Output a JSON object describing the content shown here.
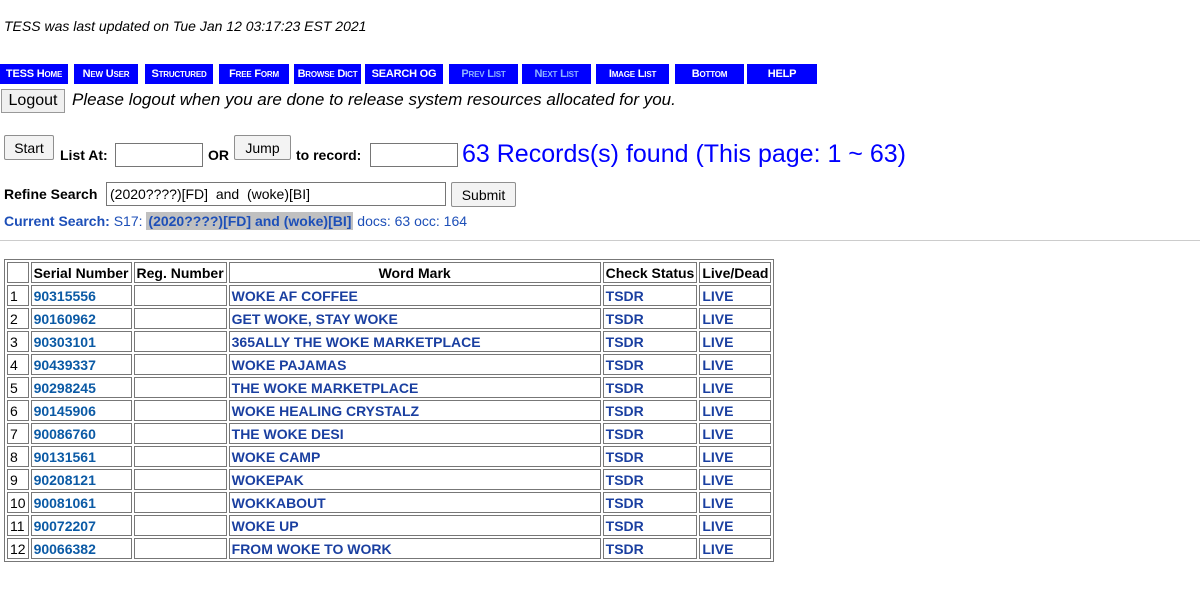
{
  "header": {
    "updated": "TESS was last updated on Tue Jan 12 03:17:23 EST 2021"
  },
  "nav": [
    {
      "label": "TESS Home",
      "dim": false
    },
    {
      "label": "New User",
      "dim": false
    },
    {
      "label": "Structured",
      "dim": false
    },
    {
      "label": "Free Form",
      "dim": false
    },
    {
      "label": "Browse Dict",
      "dim": false
    },
    {
      "label": "SEARCH OG",
      "dim": false
    },
    {
      "label": "Prev List",
      "dim": true
    },
    {
      "label": "Next List",
      "dim": true
    },
    {
      "label": "Image List",
      "dim": false
    },
    {
      "label": "Bottom",
      "dim": false
    },
    {
      "label": "HELP",
      "dim": false
    }
  ],
  "logout": {
    "button": "Logout",
    "message": "Please logout when you are done to release system resources allocated for you."
  },
  "listnav": {
    "start": "Start",
    "list_at": "List At:",
    "or": "OR",
    "jump": "Jump",
    "to_record": "to record:",
    "list_at_value": "",
    "record_value": ""
  },
  "records_found": "63 Records(s) found (This page: 1 ~ 63)",
  "refine": {
    "label": "Refine Search",
    "value": "(2020????)[FD]  and  (woke)[BI]",
    "submit": "Submit"
  },
  "current": {
    "label": "Current Search:",
    "id": "S17:",
    "query": "(2020????)[FD] and (woke)[BI]",
    "stats": "docs: 63 occ: 164"
  },
  "table": {
    "headers": [
      "",
      "Serial Number",
      "Reg. Number",
      "Word Mark",
      "Check Status",
      "Live/Dead"
    ],
    "rows": [
      {
        "n": "1",
        "serial": "90315556",
        "reg": "",
        "mark": "WOKE AF COFFEE",
        "check": "TSDR",
        "status": "LIVE"
      },
      {
        "n": "2",
        "serial": "90160962",
        "reg": "",
        "mark": "GET WOKE, STAY WOKE",
        "check": "TSDR",
        "status": "LIVE"
      },
      {
        "n": "3",
        "serial": "90303101",
        "reg": "",
        "mark": "365ALLY THE WOKE MARKETPLACE",
        "check": "TSDR",
        "status": "LIVE"
      },
      {
        "n": "4",
        "serial": "90439337",
        "reg": "",
        "mark": "WOKE PAJAMAS",
        "check": "TSDR",
        "status": "LIVE"
      },
      {
        "n": "5",
        "serial": "90298245",
        "reg": "",
        "mark": "THE WOKE MARKETPLACE",
        "check": "TSDR",
        "status": "LIVE"
      },
      {
        "n": "6",
        "serial": "90145906",
        "reg": "",
        "mark": "WOKE HEALING CRYSTALZ",
        "check": "TSDR",
        "status": "LIVE"
      },
      {
        "n": "7",
        "serial": "90086760",
        "reg": "",
        "mark": "THE WOKE DESI",
        "check": "TSDR",
        "status": "LIVE"
      },
      {
        "n": "8",
        "serial": "90131561",
        "reg": "",
        "mark": "WOKE CAMP",
        "check": "TSDR",
        "status": "LIVE"
      },
      {
        "n": "9",
        "serial": "90208121",
        "reg": "",
        "mark": "WOKEPAK",
        "check": "TSDR",
        "status": "LIVE"
      },
      {
        "n": "10",
        "serial": "90081061",
        "reg": "",
        "mark": "WOKKABOUT",
        "check": "TSDR",
        "status": "LIVE"
      },
      {
        "n": "11",
        "serial": "90072207",
        "reg": "",
        "mark": "WOKE UP",
        "check": "TSDR",
        "status": "LIVE"
      },
      {
        "n": "12",
        "serial": "90066382",
        "reg": "",
        "mark": "FROM WOKE TO WORK",
        "check": "TSDR",
        "status": "LIVE"
      }
    ]
  },
  "colors": {
    "nav_bg": "#0000ff",
    "link": "#0b5aa5",
    "records": "#0000ff"
  }
}
